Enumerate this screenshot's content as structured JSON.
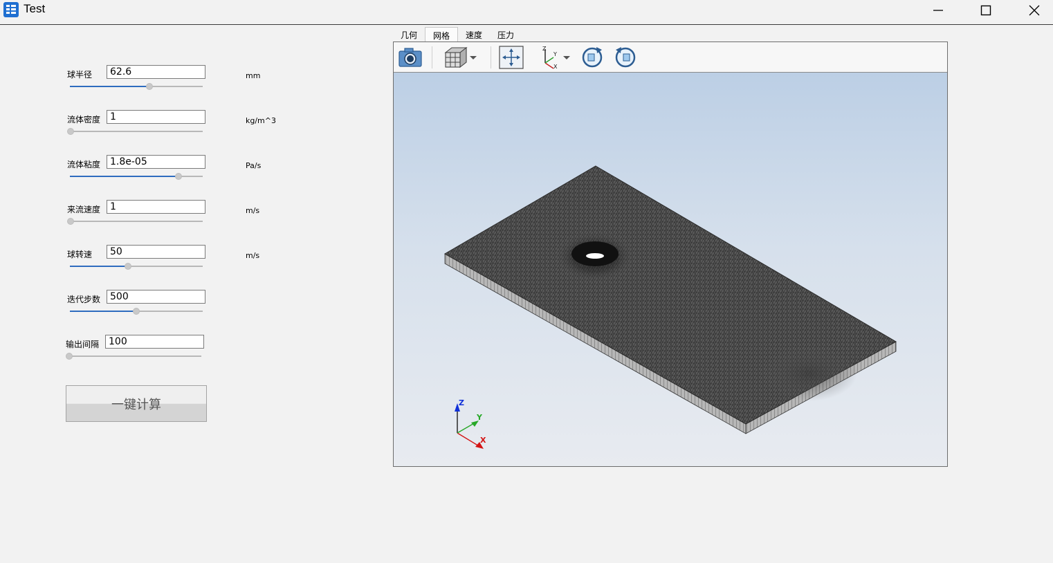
{
  "window": {
    "title": "Test"
  },
  "params": [
    {
      "label": "球半径",
      "value": "62.6",
      "unit": "mm",
      "slider": 0.6
    },
    {
      "label": "流体密度",
      "value": "1",
      "unit": "kg/m^3",
      "slider": 0.0
    },
    {
      "label": "流体粘度",
      "value": "1.8e-05",
      "unit": "Pa/s",
      "slider": 0.82
    },
    {
      "label": "来流速度",
      "value": "1",
      "unit": "m/s",
      "slider": 0.0
    },
    {
      "label": "球转速",
      "value": "50",
      "unit": "m/s",
      "slider": 0.44
    },
    {
      "label": "迭代步数",
      "value": "500",
      "unit": "",
      "slider": 0.5
    },
    {
      "label": "输出间隔",
      "value": "100",
      "unit": "",
      "slider": 0.0
    }
  ],
  "calc_button": "一键计算",
  "tabs": [
    {
      "label": "几何",
      "active": false
    },
    {
      "label": "网格",
      "active": true
    },
    {
      "label": "速度",
      "active": false
    },
    {
      "label": "压力",
      "active": false
    }
  ],
  "toolbar": {
    "icons": [
      "camera-icon",
      "cube-view-icon",
      "fit-view-icon",
      "axes-icon",
      "rotate-cw-icon",
      "rotate-ccw-icon"
    ]
  },
  "axes_labels": {
    "x": "X",
    "y": "Y",
    "z": "Z"
  },
  "colors": {
    "slider_fill": "#2e6cbf",
    "viewer_top": "#bccfe5",
    "viewer_bottom": "#e8ebf0",
    "mesh": "#555555"
  }
}
